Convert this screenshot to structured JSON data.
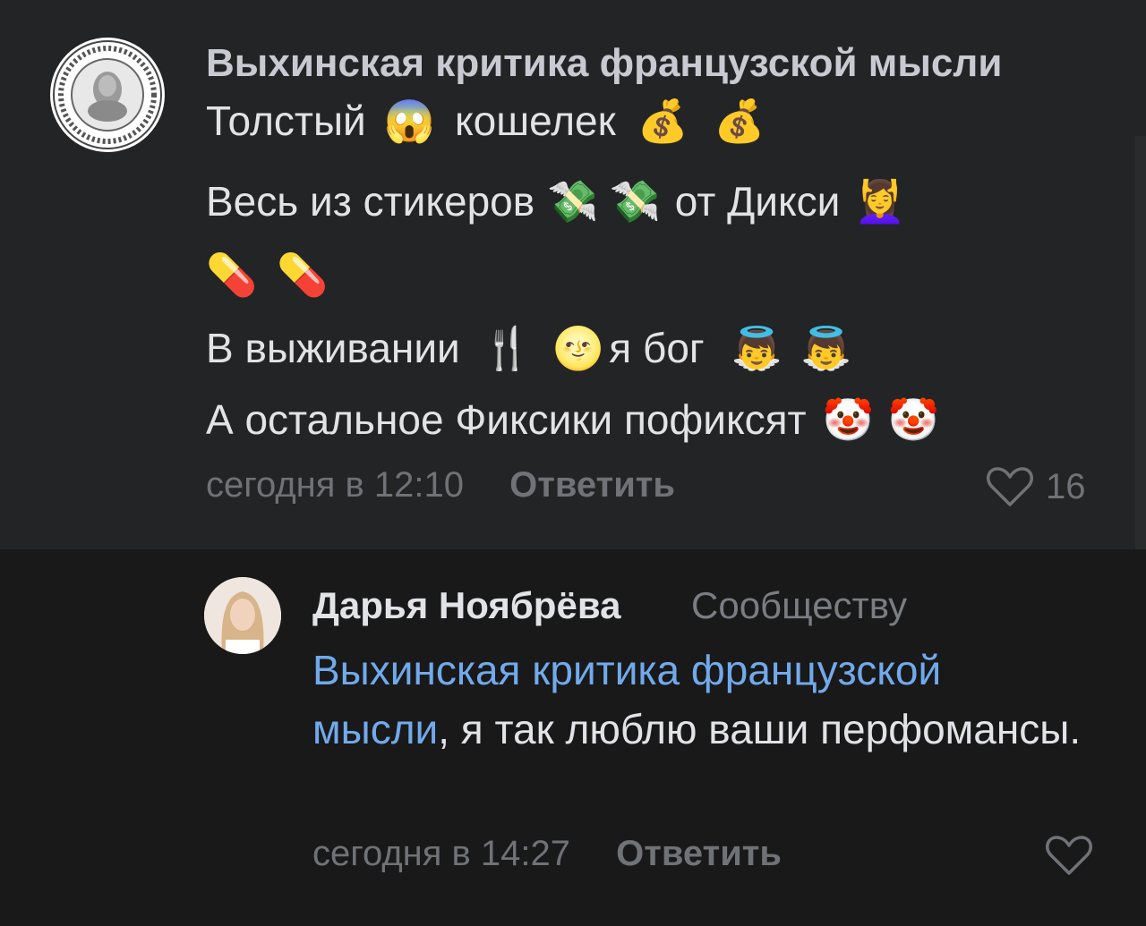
{
  "comments": [
    {
      "author": "Выхинская критика французской мысли",
      "lines": [
        {
          "parts": [
            "Толстый",
            "😱",
            "кошелек",
            "💰",
            "💰"
          ]
        },
        {
          "parts": [
            "Весь из стикеров",
            "💸",
            "💸",
            "от Дикси",
            "💆‍♀️"
          ]
        },
        {
          "parts": [
            "💊",
            "💊"
          ]
        },
        {
          "parts": [
            "В выживании",
            "🍴",
            "🌝",
            "я бог",
            "👼",
            "👼"
          ]
        },
        {
          "parts": [
            "А остальное Фиксики пофиксят",
            "🤡",
            "🤡"
          ]
        }
      ],
      "time": "сегодня в 12:10",
      "reply_label": "Ответить",
      "likes": "16",
      "avatar_icon": "seal-logo-avatar"
    },
    {
      "author": "Дарья Ноябрёва",
      "reply_to": "Сообществу",
      "mention": "Выхинская критика французской мысли",
      "text": ", я так люблю ваши перфомансы.",
      "time": "сегодня в 14:27",
      "reply_label": "Ответить",
      "avatar_icon": "user-photo-avatar"
    }
  ],
  "colors": {
    "top_bg": "#232426",
    "reply_bg": "#19191a",
    "mention": "#71aaeb",
    "meta": "#6f7276"
  }
}
